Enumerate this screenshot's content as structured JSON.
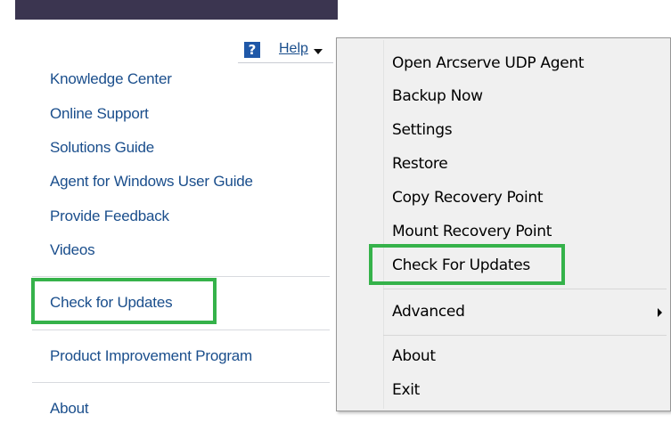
{
  "help": {
    "icon_glyph": "?",
    "label": "Help"
  },
  "left_menu": {
    "items": [
      "Knowledge Center",
      "Online Support",
      "Solutions Guide",
      "Agent for Windows User Guide",
      "Provide Feedback",
      "Videos",
      "Check for Updates",
      "Product Improvement Program",
      "About"
    ]
  },
  "context_menu": {
    "items": [
      "Open Arcserve UDP Agent",
      "Backup Now",
      "Settings",
      "Restore",
      "Copy Recovery Point",
      "Mount Recovery Point",
      "Check For Updates",
      "Advanced",
      "About",
      "Exit"
    ]
  },
  "colors": {
    "link": "#1a4e8c",
    "highlight": "#35b24a",
    "menu_bg": "#f0f0f0"
  }
}
